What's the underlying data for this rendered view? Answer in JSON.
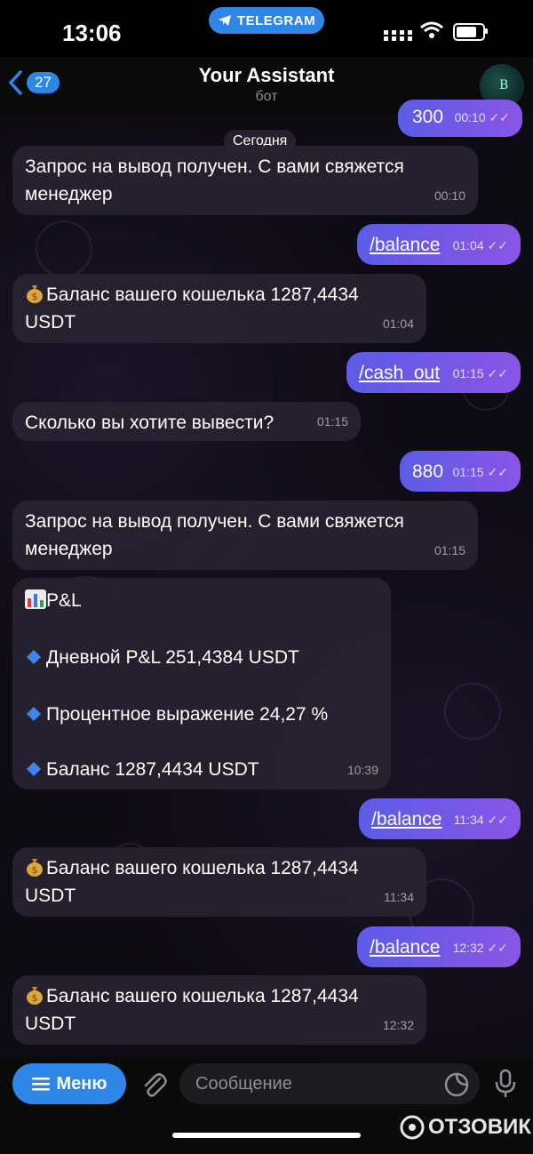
{
  "status_bar": {
    "time": "13:06",
    "app_pill": "TELEGRAM"
  },
  "header": {
    "back_count": "27",
    "title": "Your Assistant",
    "subtitle": "бот",
    "avatar_letter": "B"
  },
  "date_pill": "Сегодня",
  "messages": [
    {
      "dir": "out",
      "text": "300",
      "time": "00:10"
    },
    {
      "dir": "in",
      "line1": "Запрос на вывод получен. С вами свяжется",
      "line2": "менеджер",
      "time": "00:10"
    },
    {
      "dir": "out",
      "text": "/balance",
      "time": "01:04"
    },
    {
      "dir": "in",
      "line1": "Баланс вашего кошелька 1287,4434",
      "line2": "USDT",
      "time": "01:04"
    },
    {
      "dir": "out",
      "text": "/cash_out",
      "time": "01:15"
    },
    {
      "dir": "in",
      "text": "Сколько вы хотите вывести?",
      "time": "01:15"
    },
    {
      "dir": "out",
      "text": "880",
      "time": "01:15"
    },
    {
      "dir": "in",
      "line1": "Запрос на вывод получен. С вами свяжется",
      "line2": "менеджер",
      "time": "01:15"
    },
    {
      "dir": "in",
      "heading": "P&L",
      "l1": "Дневной P&L 251,4384 USDT",
      "l2": "Процентное выражение 24,27 %",
      "l3": "Баланс 1287,4434 USDT",
      "time": "10:39"
    },
    {
      "dir": "out",
      "text": "/balance",
      "time": "11:34"
    },
    {
      "dir": "in",
      "line1": "Баланс вашего кошелька 1287,4434",
      "line2": "USDT",
      "time": "11:34"
    },
    {
      "dir": "out",
      "text": "/balance",
      "time": "12:32"
    },
    {
      "dir": "in",
      "line1": "Баланс вашего кошелька 1287,4434",
      "line2": "USDT",
      "time": "12:32"
    }
  ],
  "input_bar": {
    "menu_label": "Меню",
    "placeholder": "Сообщение"
  },
  "watermark": "ОТЗОВИК",
  "colors": {
    "accent": "#2e86e6",
    "outgoing_start": "#5b5ce6",
    "outgoing_end": "#8a55e6",
    "incoming": "#262230"
  }
}
